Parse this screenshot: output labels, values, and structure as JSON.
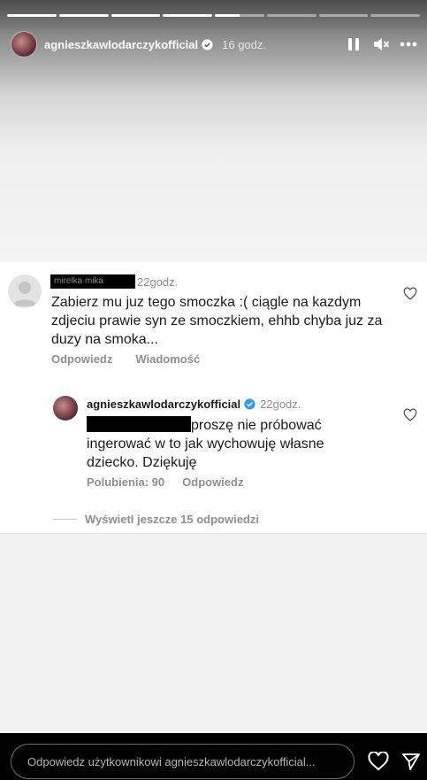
{
  "story": {
    "segments": [
      1,
      1,
      1,
      1,
      0.5,
      0,
      0,
      0
    ],
    "username": "agnieszkawlodarczykofficial",
    "posted_ago": "16 godz."
  },
  "comment": {
    "author_redacted_text": "mirelka mika",
    "time": "22godz.",
    "text": "Zabierz mu juz tego smoczka :( ciągle na kazdym zdjeciu prawie syn ze smoczkiem, ehhb chyba juz za duzy na smoka...",
    "reply_label": "Odpowiedz",
    "message_label": "Wiadomość"
  },
  "reply": {
    "username": "agnieszkawlodarczykofficial",
    "time": "22godz.",
    "text": "proszę nie próbować ingerować w to jak wychowuję własne dziecko. Dziękuję",
    "likes_label": "Polubienia: 90",
    "reply_label": "Odpowiedz"
  },
  "more_replies_label": "Wyświetl jeszcze 15 odpowiedzi",
  "bottom": {
    "placeholder": "Odpowiedz użytkownikowi agnieszkawlodarczykofficial..."
  },
  "colors": {
    "verified": "#3897f0",
    "muted": "#8e8e8e"
  }
}
